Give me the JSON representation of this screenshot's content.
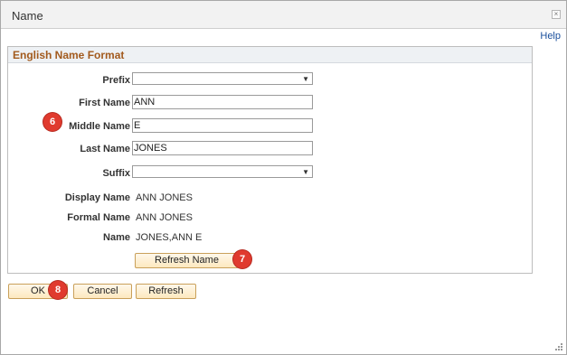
{
  "dialog": {
    "title": "Name",
    "close_glyph": "×",
    "help_label": "Help"
  },
  "group": {
    "title": "English Name Format"
  },
  "fields": {
    "prefix": {
      "label": "Prefix",
      "value": ""
    },
    "first_name": {
      "label": "First Name",
      "value": "ANN"
    },
    "middle_name": {
      "label": "Middle Name",
      "value": "E"
    },
    "last_name": {
      "label": "Last Name",
      "value": "JONES"
    },
    "suffix": {
      "label": "Suffix",
      "value": ""
    }
  },
  "display": {
    "display_name": {
      "label": "Display Name",
      "value": "ANN JONES"
    },
    "formal_name": {
      "label": "Formal Name",
      "value": "ANN JONES"
    },
    "name": {
      "label": "Name",
      "value": "JONES,ANN E"
    }
  },
  "buttons": {
    "refresh_name": "Refresh Name",
    "ok": "OK",
    "cancel": "Cancel",
    "refresh": "Refresh"
  },
  "callouts": {
    "middle_name": "6",
    "refresh_name": "7",
    "ok": "8"
  },
  "colors": {
    "callout": "#e03a2e",
    "group_title": "#a25a1d",
    "link": "#1a4f9c",
    "button_border": "#c9a05a"
  },
  "icons": {
    "close": "close-icon",
    "dropdown": "chevron-down-icon",
    "resize": "resize-grip-icon"
  }
}
